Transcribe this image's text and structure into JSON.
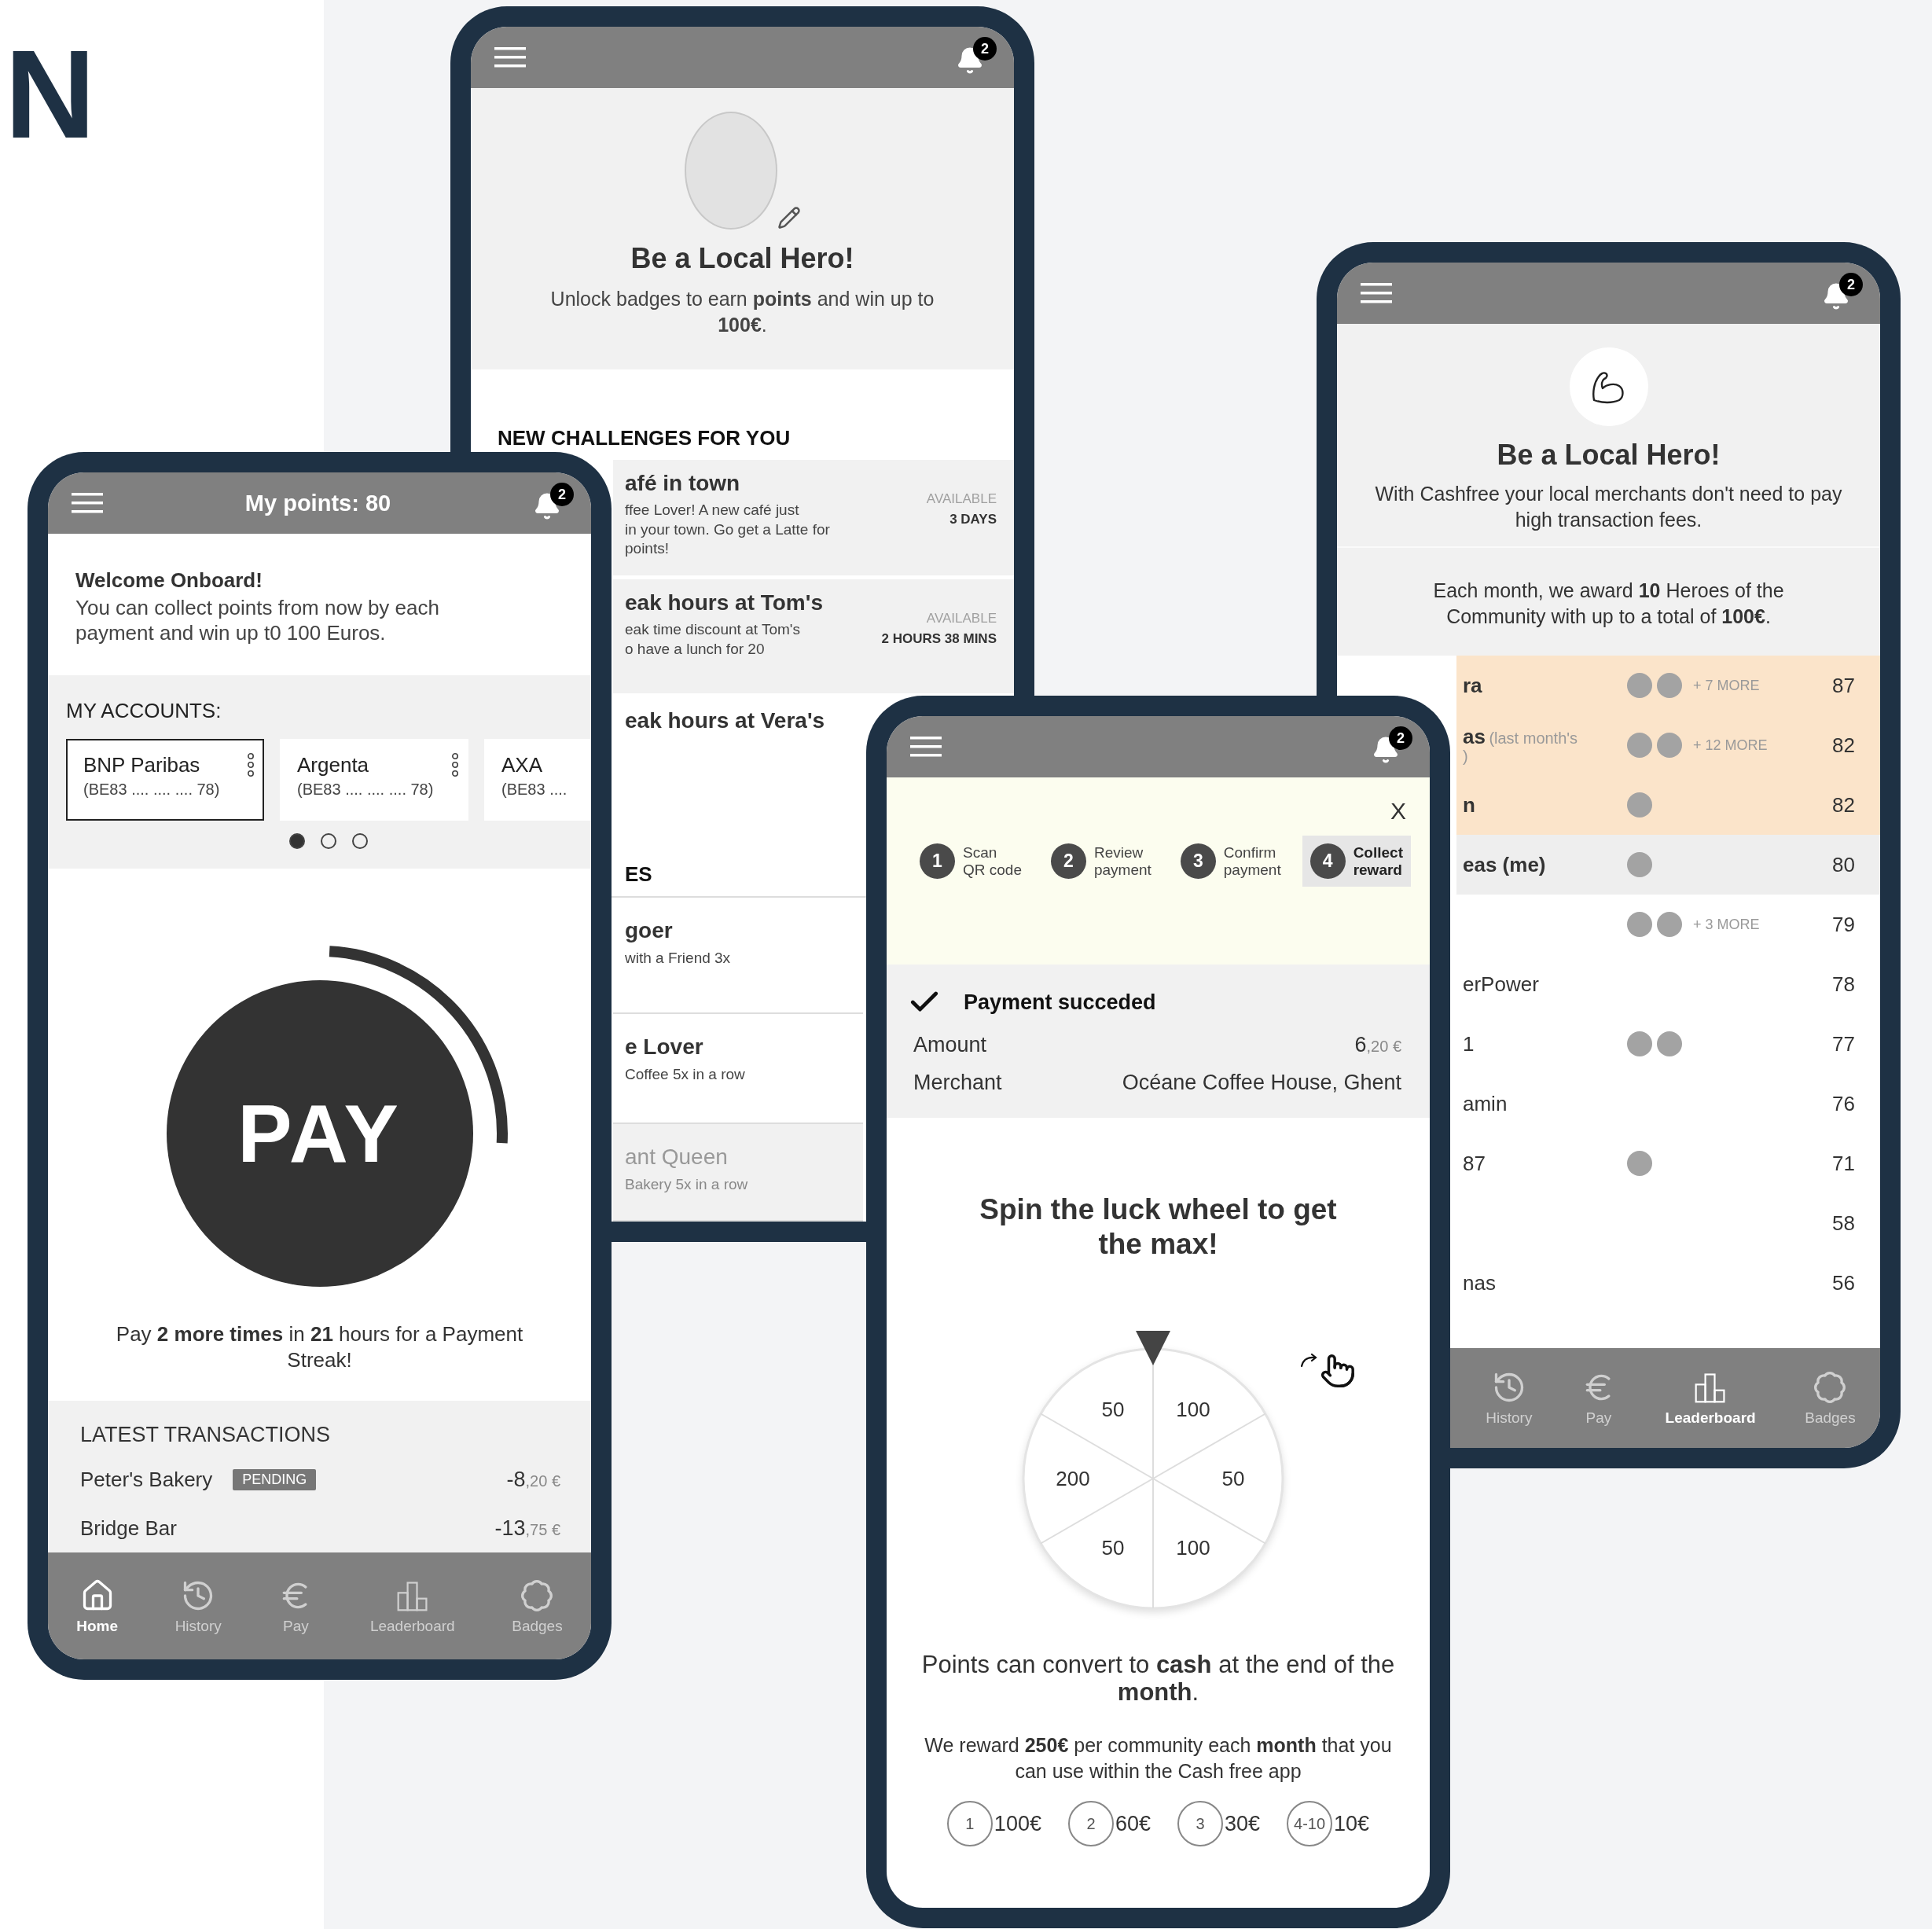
{
  "logo": "N",
  "challenges_screen": {
    "notifications": "2",
    "hero": {
      "title": "Be a Local Hero!",
      "text": "Unlock badges to earn **points** and win up to **100€**."
    },
    "challenges_heading": "NEW CHALLENGES FOR YOU",
    "challenges": [
      {
        "kind": "timed",
        "title": "afé in town",
        "description_lines": [
          "ffee Lover! A new café just",
          "in your town. Go get a Latte for",
          "points!"
        ],
        "availability_label": "AVAILABLE",
        "availability": "3 DAYS"
      },
      {
        "kind": "timed",
        "title": "eak hours at Tom's",
        "description_lines": [
          "eak time discount at Tom's",
          "o have a lunch for 20"
        ],
        "availability_label": "AVAILABLE",
        "availability": "2 HOURS 38 MINS"
      },
      {
        "kind": "plain",
        "title": "eak hours at Vera's"
      }
    ],
    "badges_heading": "ES",
    "badges": [
      {
        "title": "goer",
        "description": "with a Friend 3x",
        "locked": false
      },
      {
        "title": "e Lover",
        "description": "Coffee 5x in a row",
        "locked": false
      },
      {
        "title": "ant Queen",
        "description": "Bakery 5x in a row",
        "locked": true
      }
    ]
  },
  "leaderboard_screen": {
    "notifications": "2",
    "title": "Be a Local Hero!",
    "intro": "With Cashfree your local merchants don't need to pay high transaction fees.",
    "award_text": "Each month, we award **10** Heroes of the Community with up to a total of **100€**.",
    "rows": [
      {
        "kind": "top",
        "name": "ra",
        "badges": [
          {
            "kind": "badge"
          },
          {
            "kind": "badge"
          }
        ],
        "more": "+ 7 MORE",
        "score": "87"
      },
      {
        "kind": "top",
        "name": "as",
        "note_lines": [
          "(last month's",
          ")"
        ],
        "badges": [
          {
            "kind": "badge"
          },
          {
            "kind": "badge"
          }
        ],
        "more": "+ 12 MORE",
        "score": "82"
      },
      {
        "kind": "top",
        "name": "n",
        "badges": [
          {
            "kind": "badge"
          }
        ],
        "score": "82"
      },
      {
        "kind": "me",
        "name": "eas (me)",
        "badges": [
          {
            "kind": "badge"
          }
        ],
        "score": "80"
      },
      {
        "kind": "normal",
        "badges": [
          {
            "kind": "badge"
          },
          {
            "kind": "badge"
          }
        ],
        "more": "+ 3 MORE",
        "score": "79"
      },
      {
        "kind": "normal",
        "name": "erPower",
        "score": "78"
      },
      {
        "kind": "normal",
        "name": "1",
        "badges": [
          {
            "kind": "badge"
          },
          {
            "kind": "badge"
          }
        ],
        "score": "77"
      },
      {
        "kind": "normal",
        "name": "amin",
        "score": "76"
      },
      {
        "kind": "normal",
        "name": "87",
        "badges": [
          {
            "kind": "badge"
          }
        ],
        "score": "71"
      },
      {
        "kind": "normal",
        "score": "58"
      },
      {
        "kind": "normal",
        "name": "nas",
        "score": "56"
      }
    ],
    "nav": [
      {
        "kind": "history",
        "label": "History",
        "selected": false
      },
      {
        "kind": "pay",
        "label": "Pay",
        "selected": false
      },
      {
        "kind": "leaderboard",
        "label": "Leaderboard",
        "selected": true
      },
      {
        "kind": "badges",
        "label": "Badges",
        "selected": false
      }
    ]
  },
  "home_screen": {
    "title": "My points: 80",
    "notifications": "2",
    "welcome_title": "Welcome Onboard!",
    "welcome_text": "You can collect points from now by each payment and win up t0 100 Euros.",
    "accounts_heading": "MY ACCOUNTS:",
    "accounts": [
      {
        "bank": "BNP Paribas",
        "iban": "(BE83 .... .... .... 78)",
        "selected": true
      },
      {
        "bank": "Argenta",
        "iban": "(BE83 .... .... .... 78)",
        "selected": false
      },
      {
        "bank": "AXA",
        "iban": "(BE83 ....",
        "selected": false
      }
    ],
    "pager": [
      {
        "selected": true
      },
      {
        "selected": false
      },
      {
        "selected": false
      }
    ],
    "pay": {
      "label": "PAY",
      "streak_text": "Pay **2 more times** in **21** hours for a Payment Streak!"
    },
    "transactions_heading": "LATEST TRANSACTIONS",
    "transactions": [
      {
        "merchant": "Peter's Bakery",
        "status": "PENDING",
        "amount_main": "-8",
        "amount_cents": ",20 €"
      },
      {
        "merchant": "Bridge Bar",
        "amount_main": "-13",
        "amount_cents": ",75 €"
      }
    ],
    "nav": [
      {
        "kind": "home",
        "label": "Home",
        "selected": true
      },
      {
        "kind": "history",
        "label": "History",
        "selected": false
      },
      {
        "kind": "pay",
        "label": "Pay",
        "selected": false
      },
      {
        "kind": "leaderboard",
        "label": "Leaderboard",
        "selected": false
      },
      {
        "kind": "badges",
        "label": "Badges",
        "selected": false
      }
    ]
  },
  "payment_screen": {
    "notifications": "2",
    "close": "X",
    "steps": [
      {
        "number": "1",
        "label_lines": [
          "Scan",
          "QR code"
        ],
        "selected": false
      },
      {
        "number": "2",
        "label_lines": [
          "Review",
          "payment"
        ],
        "selected": false
      },
      {
        "number": "3",
        "label_lines": [
          "Confirm",
          "payment"
        ],
        "selected": false
      },
      {
        "number": "4",
        "label_lines": [
          "Collect",
          "reward"
        ],
        "selected": true
      }
    ],
    "status": "Payment succeded",
    "details": [
      {
        "kind": "money",
        "label": "Amount",
        "value_main": "6",
        "value_cents": ",20 €"
      },
      {
        "kind": "text",
        "label": "Merchant",
        "value": "Océane Coffee House, Ghent"
      }
    ],
    "spin_title": "Spin the luck wheel to get the max!",
    "wheel_segments": [
      "100",
      "50",
      "100",
      "50",
      "200",
      "50"
    ],
    "convert_text": "Points can convert to **cash** at the end of the **month**.",
    "reward_text": "We reward **250€** per community each **month** that you can use within the Cash free app",
    "prizes": [
      {
        "rank": "1",
        "amount": "100€"
      },
      {
        "rank": "2",
        "amount": "60€"
      },
      {
        "rank": "3",
        "amount": "30€"
      },
      {
        "rank": "4-10",
        "amount": "10€"
      }
    ]
  }
}
